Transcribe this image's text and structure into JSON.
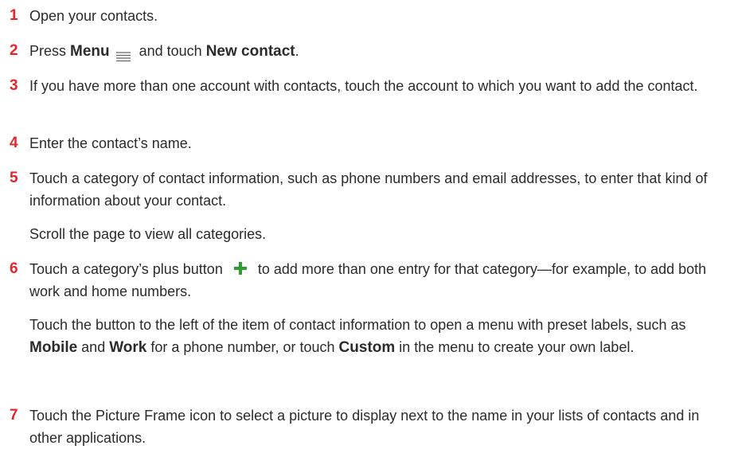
{
  "steps": [
    {
      "num": "1",
      "text": "Open your contacts."
    },
    {
      "num": "2",
      "pre": "Press ",
      "menu_label": "Menu",
      "icon": "menu-lines-icon",
      "mid": " and touch ",
      "new_contact_label": "New contact",
      "post": "."
    },
    {
      "num": "3",
      "text": "If you have more than one account with contacts, touch the account to which you want to add the contact."
    },
    {
      "num": "4",
      "text": "Enter the contact’s name."
    },
    {
      "num": "5",
      "text": "Touch a category of contact information, such as phone numbers and email addresses, to enter that kind of information about your contact.",
      "sub": "Scroll the page to view all categories."
    },
    {
      "num": "6",
      "pre": "Touch a category’s plus button",
      "icon": "plus-icon",
      "icon_color": "#2e9e2e",
      "post": "to add more than one entry for that category—for example, to add both work and home numbers.",
      "sub_pre": "Touch the button to the left of the item of contact information to open a menu with preset labels, such as ",
      "mobile_label": "Mobile",
      "sub_and": " and ",
      "work_label": "Work",
      "sub_mid": " for a phone number, or touch ",
      "custom_label": "Custom",
      "sub_post": " in the menu to create your own label."
    },
    {
      "num": "7",
      "text": "Touch the Picture Frame icon to select a picture to display next to the name in your lists of contacts and in other applications."
    }
  ]
}
